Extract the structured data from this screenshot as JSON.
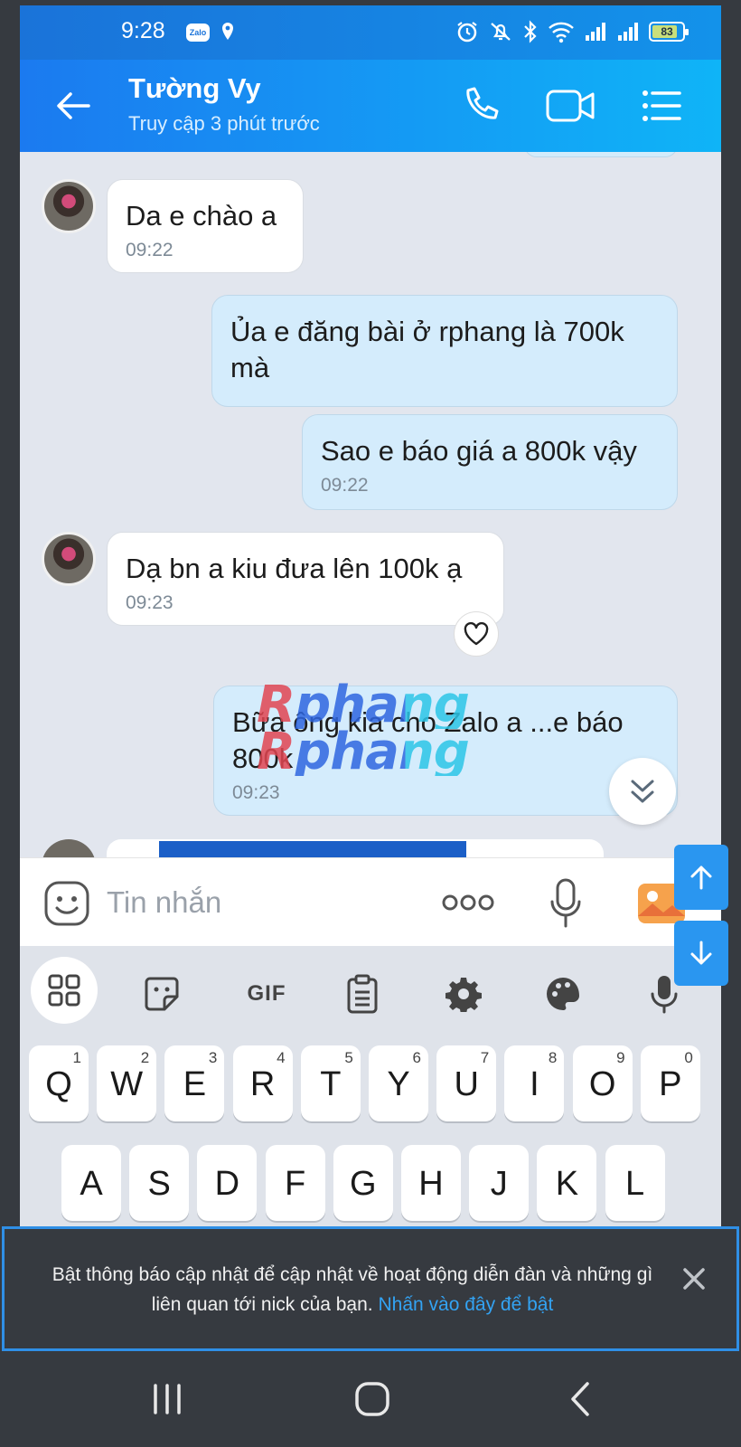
{
  "status_bar": {
    "time": "9:28",
    "zalo_badge": "Zalo",
    "battery": "83",
    "battery_level": 0.83,
    "icons": [
      "alarm-icon",
      "mute-icon",
      "bluetooth-icon",
      "wifi-icon",
      "signal-icon",
      "signal-icon",
      "battery-icon"
    ]
  },
  "header": {
    "contact_name": "Tường Vy",
    "contact_status": "Truy cập 3 phút trước",
    "icons": [
      "back-arrow-icon",
      "phone-icon",
      "video-icon",
      "menu-icon"
    ]
  },
  "messages": [
    {
      "direction": "in",
      "text": "Da e chào a",
      "time": "09:22"
    },
    {
      "direction": "out",
      "text": "Ủa e đăng bài ở rphang là 700k mà",
      "time": ""
    },
    {
      "direction": "out",
      "text": "Sao e báo giá a 800k vậy",
      "time": "09:22"
    },
    {
      "direction": "in",
      "text": "Dạ bn a kiu đưa lên 100k ạ",
      "time": "09:23"
    },
    {
      "direction": "out",
      "text": "Bữa ông kia cho Zalo a ...e báo 800k",
      "time": "09:23"
    }
  ],
  "watermark": {
    "line1": "Rphang",
    "line2": "Rphang"
  },
  "input": {
    "placeholder": "Tin nhắn",
    "value": ""
  },
  "keyboard": {
    "toolbar": [
      "apps-grid-icon",
      "sticker-icon",
      "GIF",
      "clipboard-icon",
      "settings-icon",
      "palette-icon",
      "voice-input-icon"
    ],
    "gif_label": "GIF",
    "row1": [
      {
        "key": "Q",
        "hint": "1"
      },
      {
        "key": "W",
        "hint": "2"
      },
      {
        "key": "E",
        "hint": "3"
      },
      {
        "key": "R",
        "hint": "4"
      },
      {
        "key": "T",
        "hint": "5"
      },
      {
        "key": "Y",
        "hint": "6"
      },
      {
        "key": "U",
        "hint": "7"
      },
      {
        "key": "I",
        "hint": "8"
      },
      {
        "key": "O",
        "hint": "9"
      },
      {
        "key": "P",
        "hint": "0"
      }
    ],
    "row2": [
      "A",
      "S",
      "D",
      "F",
      "G",
      "H",
      "J",
      "K",
      "L"
    ]
  },
  "notification": {
    "text": "Bật thông báo cập nhật để cập nhật về hoạt động diễn đàn và những gì liên quan tới nick của bạn.",
    "link": "Nhấn vào đây để bật"
  },
  "colors": {
    "header_start": "#1b7af0",
    "header_end": "#0fb4f7",
    "bubble_out": "#d4ecfc",
    "bubble_in": "#ffffff",
    "link": "#33a3f3",
    "float_button": "#2a96f0"
  }
}
